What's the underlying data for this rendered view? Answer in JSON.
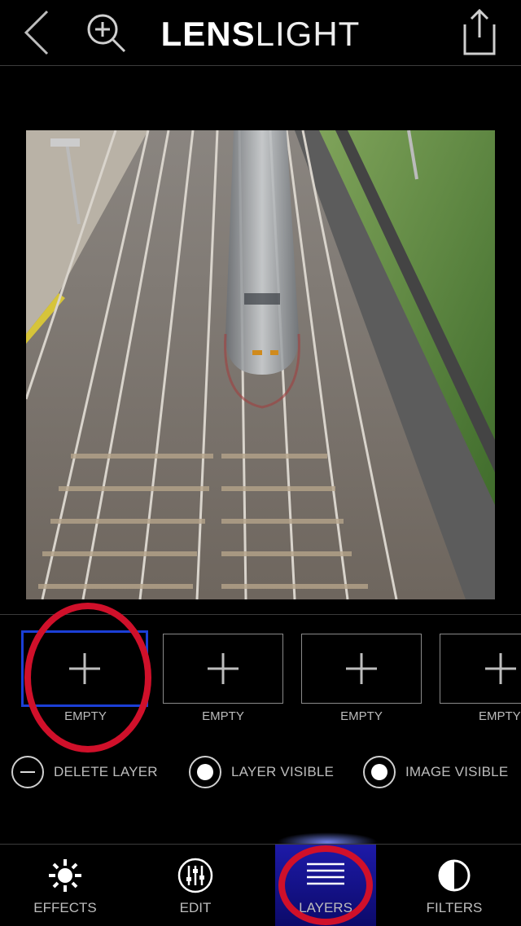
{
  "header": {
    "brand_bold": "LENS",
    "brand_light": "LIGHT"
  },
  "photo": {
    "subject": ""
  },
  "layers": {
    "slots": [
      {
        "label": "EMPTY"
      },
      {
        "label": "EMPTY"
      },
      {
        "label": "EMPTY"
      },
      {
        "label": "EMPTY"
      }
    ],
    "options": {
      "delete": "DELETE LAYER",
      "layer_visible": "LAYER VISIBLE",
      "image_visible": "IMAGE VISIBLE"
    }
  },
  "tabs": {
    "effects": "EFFECTS",
    "edit": "EDIT",
    "layers": "LAYERS",
    "filters": "FILTERS",
    "active": "LAYERS"
  },
  "colors": {
    "accent": "#1b3fd6",
    "annotation": "#d0102a"
  }
}
